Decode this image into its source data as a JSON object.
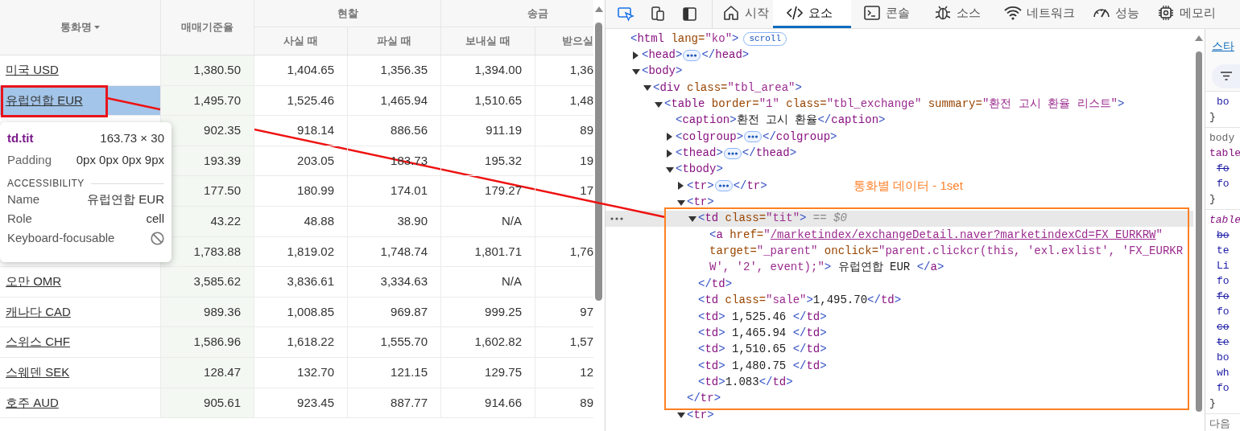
{
  "rate_table": {
    "header": {
      "currency": "통화명",
      "base_rate": "매매기준율",
      "cash": "현찰",
      "cash_buy": "사실 때",
      "cash_sell": "파실 때",
      "remit": "송금",
      "remit_send": "보내실 때",
      "remit_receive": "받으실"
    },
    "rows": [
      {
        "name": "미국 USD",
        "values": [
          "1,380.50",
          "1,404.65",
          "1,356.35",
          "1,394.00",
          "1,36"
        ]
      },
      {
        "name": "유럽연합 EUR",
        "values": [
          "1,495.70",
          "1,525.46",
          "1,465.94",
          "1,510.65",
          "1,48"
        ]
      },
      {
        "values": [
          "902.35",
          "918.14",
          "886.56",
          "911.19",
          "89"
        ]
      },
      {
        "values": [
          "193.39",
          "203.05",
          "183.73",
          "195.32",
          "19"
        ]
      },
      {
        "values": [
          "177.50",
          "180.99",
          "174.01",
          "179.27",
          "17"
        ]
      },
      {
        "values": [
          "43.22",
          "48.88",
          "38.90",
          "N/A"
        ]
      },
      {
        "values": [
          "1,783.88",
          "1,819.02",
          "1,748.74",
          "1,801.71",
          "1,76"
        ]
      },
      {
        "name": "오만 OMR",
        "values": [
          "3,585.62",
          "3,836.61",
          "3,334.63",
          "N/A"
        ]
      },
      {
        "name": "캐나다 CAD",
        "values": [
          "989.36",
          "1,008.85",
          "969.87",
          "999.25",
          "97"
        ]
      },
      {
        "name": "스위스 CHF",
        "values": [
          "1,586.96",
          "1,618.22",
          "1,555.70",
          "1,602.82",
          "1,57"
        ]
      },
      {
        "name": "스웨덴 SEK",
        "values": [
          "128.47",
          "132.70",
          "121.15",
          "129.75",
          "12"
        ]
      },
      {
        "name": "호주 AUD",
        "values": [
          "905.61",
          "923.45",
          "887.77",
          "914.66",
          "89"
        ]
      }
    ]
  },
  "inspector_tooltip": {
    "selector": "td.tit",
    "size": "163.73 × 30",
    "padding_label": "Padding",
    "padding": "0px 0px 0px 9px",
    "section": "ACCESSIBILITY",
    "properties": [
      {
        "label": "Name",
        "value": "유럽연합 EUR",
        "kind": "text"
      },
      {
        "label": "Role",
        "value": "cell",
        "kind": "text"
      },
      {
        "label": "Keyboard-focusable",
        "kind": "blocked"
      }
    ]
  },
  "devtools": {
    "tabs": [
      {
        "label": "시작",
        "selected": false
      },
      {
        "label": "요소",
        "selected": true
      },
      {
        "label": "콘솔",
        "selected": false
      },
      {
        "label": "소스",
        "selected": false
      },
      {
        "label": "네트워크",
        "selected": false
      },
      {
        "label": "성능",
        "selected": false
      },
      {
        "label": "메모리",
        "selected": false
      }
    ],
    "dom_tree": [
      {
        "selected": false,
        "lines": [
          [
            {
              "kind": "bracket",
              "text": "<"
            },
            {
              "kind": "tag",
              "text": "html"
            },
            {
              "kind": "attr",
              "text": " lang="
            },
            {
              "kind": "value",
              "text": "\"ko\""
            },
            {
              "kind": "bracket",
              "text": ">"
            },
            {
              "kind": "badge",
              "text": "scroll"
            }
          ]
        ],
        "children": [
          {
            "selected": false,
            "expanded": false,
            "lines": [
              [
                {
                  "kind": "bracket",
                  "text": "<"
                },
                {
                  "kind": "tag",
                  "text": "head"
                },
                {
                  "kind": "bracket",
                  "text": ">"
                },
                {
                  "kind": "more"
                },
                {
                  "kind": "bracket",
                  "text": "</"
                },
                {
                  "kind": "tag",
                  "text": "head"
                },
                {
                  "kind": "bracket",
                  "text": ">"
                }
              ]
            ]
          },
          {
            "selected": false,
            "expanded": true,
            "lines": [
              [
                {
                  "kind": "bracket",
                  "text": "<"
                },
                {
                  "kind": "tag",
                  "text": "body"
                },
                {
                  "kind": "bracket",
                  "text": ">"
                }
              ]
            ],
            "children": [
              {
                "selected": false,
                "expanded": true,
                "lines": [
                  [
                    {
                      "kind": "bracket",
                      "text": "<"
                    },
                    {
                      "kind": "tag",
                      "text": "div"
                    },
                    {
                      "kind": "attr",
                      "text": " class="
                    },
                    {
                      "kind": "value",
                      "text": "\"tbl_area\""
                    },
                    {
                      "kind": "bracket",
                      "text": ">"
                    }
                  ]
                ],
                "children": [
                  {
                    "selected": false,
                    "expanded": true,
                    "lines": [
                      [
                        {
                          "kind": "bracket",
                          "text": "<"
                        },
                        {
                          "kind": "tag",
                          "text": "table"
                        },
                        {
                          "kind": "attr",
                          "text": " border="
                        },
                        {
                          "kind": "value",
                          "text": "\"1\""
                        },
                        {
                          "kind": "attr",
                          "text": " class="
                        },
                        {
                          "kind": "value",
                          "text": "\"tbl_exchange\""
                        },
                        {
                          "kind": "attr",
                          "text": " summary="
                        },
                        {
                          "kind": "value",
                          "text": "\"환전 고시 환율 리스트\""
                        },
                        {
                          "kind": "bracket",
                          "text": ">"
                        }
                      ]
                    ],
                    "children": [
                      {
                        "selected": false,
                        "lines": [
                          [
                            {
                              "kind": "bracket",
                              "text": "<"
                            },
                            {
                              "kind": "tag",
                              "text": "caption"
                            },
                            {
                              "kind": "bracket",
                              "text": ">"
                            },
                            {
                              "kind": "text",
                              "text": "환전 고시 환율"
                            },
                            {
                              "kind": "bracket",
                              "text": "</"
                            },
                            {
                              "kind": "tag",
                              "text": "caption"
                            },
                            {
                              "kind": "bracket",
                              "text": ">"
                            }
                          ]
                        ]
                      },
                      {
                        "selected": false,
                        "expanded": false,
                        "lines": [
                          [
                            {
                              "kind": "bracket",
                              "text": "<"
                            },
                            {
                              "kind": "tag",
                              "text": "colgroup"
                            },
                            {
                              "kind": "bracket",
                              "text": ">"
                            },
                            {
                              "kind": "more"
                            },
                            {
                              "kind": "bracket",
                              "text": "</"
                            },
                            {
                              "kind": "tag",
                              "text": "colgroup"
                            },
                            {
                              "kind": "bracket",
                              "text": ">"
                            }
                          ]
                        ]
                      },
                      {
                        "selected": false,
                        "expanded": false,
                        "lines": [
                          [
                            {
                              "kind": "bracket",
                              "text": "<"
                            },
                            {
                              "kind": "tag",
                              "text": "thead"
                            },
                            {
                              "kind": "bracket",
                              "text": ">"
                            },
                            {
                              "kind": "more"
                            },
                            {
                              "kind": "bracket",
                              "text": "</"
                            },
                            {
                              "kind": "tag",
                              "text": "thead"
                            },
                            {
                              "kind": "bracket",
                              "text": ">"
                            }
                          ]
                        ]
                      },
                      {
                        "selected": false,
                        "expanded": true,
                        "lines": [
                          [
                            {
                              "kind": "bracket",
                              "text": "<"
                            },
                            {
                              "kind": "tag",
                              "text": "tbody"
                            },
                            {
                              "kind": "bracket",
                              "text": ">"
                            }
                          ]
                        ],
                        "children": [
                          {
                            "selected": false,
                            "expanded": false,
                            "lines": [
                              [
                                {
                                  "kind": "bracket",
                                  "text": "<"
                                },
                                {
                                  "kind": "tag",
                                  "text": "tr"
                                },
                                {
                                  "kind": "bracket",
                                  "text": ">"
                                },
                                {
                                  "kind": "more"
                                },
                                {
                                  "kind": "bracket",
                                  "text": "</"
                                },
                                {
                                  "kind": "tag",
                                  "text": "tr"
                                },
                                {
                                  "kind": "bracket",
                                  "text": ">"
                                }
                              ]
                            ]
                          },
                          {
                            "selected": false,
                            "expanded": true,
                            "lines": [
                              [
                                {
                                  "kind": "bracket",
                                  "text": "<"
                                },
                                {
                                  "kind": "tag",
                                  "text": "tr"
                                },
                                {
                                  "kind": "bracket",
                                  "text": ">"
                                }
                              ]
                            ],
                            "closing": [
                              {
                                "kind": "bracket",
                                "text": "</"
                              },
                              {
                                "kind": "tag",
                                "text": "tr"
                              },
                              {
                                "kind": "bracket",
                                "text": ">"
                              }
                            ],
                            "children": [
                              {
                                "selected": true,
                                "expanded": true,
                                "lines": [
                                  [
                                    {
                                      "kind": "bracket",
                                      "text": "<"
                                    },
                                    {
                                      "kind": "tag",
                                      "text": "td"
                                    },
                                    {
                                      "kind": "attr",
                                      "text": " class="
                                    },
                                    {
                                      "kind": "value",
                                      "text": "\"tit\""
                                    },
                                    {
                                      "kind": "bracket",
                                      "text": ">"
                                    },
                                    {
                                      "kind": "marker",
                                      "text": " == $0"
                                    }
                                  ]
                                ],
                                "closing": [
                                  {
                                    "kind": "bracket",
                                    "text": "</"
                                  },
                                  {
                                    "kind": "tag",
                                    "text": "td"
                                  },
                                  {
                                    "kind": "bracket",
                                    "text": ">"
                                  }
                                ],
                                "children": [
                                  {
                                    "selected": false,
                                    "lines": [
                                      [
                                        {
                                          "kind": "bracket",
                                          "text": "<"
                                        },
                                        {
                                          "kind": "tag",
                                          "text": "a"
                                        },
                                        {
                                          "kind": "attr",
                                          "text": " href="
                                        },
                                        {
                                          "kind": "value",
                                          "text": "\""
                                        },
                                        {
                                          "kind": "link",
                                          "text": "/marketindex/exchangeDetail.naver?marketindexCd=FX_EURKRW"
                                        },
                                        {
                                          "kind": "value",
                                          "text": "\""
                                        }
                                      ],
                                      [
                                        {
                                          "kind": "attr",
                                          "text": "target="
                                        },
                                        {
                                          "kind": "value",
                                          "text": "\"_parent\""
                                        },
                                        {
                                          "kind": "attr",
                                          "text": " onclick="
                                        },
                                        {
                                          "kind": "value",
                                          "text": "\"parent.clickcr(this, 'exl.exlist', 'FX_EURKR"
                                        }
                                      ],
                                      [
                                        {
                                          "kind": "value",
                                          "text": "W', '2', event);\""
                                        },
                                        {
                                          "kind": "bracket",
                                          "text": ">"
                                        },
                                        {
                                          "kind": "text",
                                          "text": " 유럽연합 EUR "
                                        },
                                        {
                                          "kind": "bracket",
                                          "text": "</"
                                        },
                                        {
                                          "kind": "tag",
                                          "text": "a"
                                        },
                                        {
                                          "kind": "bracket",
                                          "text": ">"
                                        }
                                      ]
                                    ]
                                  }
                                ]
                              },
                              {
                                "selected": false,
                                "lines": [
                                  [
                                    {
                                      "kind": "bracket",
                                      "text": "<"
                                    },
                                    {
                                      "kind": "tag",
                                      "text": "td"
                                    },
                                    {
                                      "kind": "attr",
                                      "text": " class="
                                    },
                                    {
                                      "kind": "value",
                                      "text": "\"sale\""
                                    },
                                    {
                                      "kind": "bracket",
                                      "text": ">"
                                    },
                                    {
                                      "kind": "text",
                                      "text": "1,495.70"
                                    },
                                    {
                                      "kind": "bracket",
                                      "text": "</"
                                    },
                                    {
                                      "kind": "tag",
                                      "text": "td"
                                    },
                                    {
                                      "kind": "bracket",
                                      "text": ">"
                                    }
                                  ]
                                ]
                              },
                              {
                                "selected": false,
                                "lines": [
                                  [
                                    {
                                      "kind": "bracket",
                                      "text": "<"
                                    },
                                    {
                                      "kind": "tag",
                                      "text": "td"
                                    },
                                    {
                                      "kind": "bracket",
                                      "text": ">"
                                    },
                                    {
                                      "kind": "text",
                                      "text": " 1,525.46 "
                                    },
                                    {
                                      "kind": "bracket",
                                      "text": "</"
                                    },
                                    {
                                      "kind": "tag",
                                      "text": "td"
                                    },
                                    {
                                      "kind": "bracket",
                                      "text": ">"
                                    }
                                  ]
                                ]
                              },
                              {
                                "selected": false,
                                "lines": [
                                  [
                                    {
                                      "kind": "bracket",
                                      "text": "<"
                                    },
                                    {
                                      "kind": "tag",
                                      "text": "td"
                                    },
                                    {
                                      "kind": "bracket",
                                      "text": ">"
                                    },
                                    {
                                      "kind": "text",
                                      "text": " 1,465.94 "
                                    },
                                    {
                                      "kind": "bracket",
                                      "text": "</"
                                    },
                                    {
                                      "kind": "tag",
                                      "text": "td"
                                    },
                                    {
                                      "kind": "bracket",
                                      "text": ">"
                                    }
                                  ]
                                ]
                              },
                              {
                                "selected": false,
                                "lines": [
                                  [
                                    {
                                      "kind": "bracket",
                                      "text": "<"
                                    },
                                    {
                                      "kind": "tag",
                                      "text": "td"
                                    },
                                    {
                                      "kind": "bracket",
                                      "text": ">"
                                    },
                                    {
                                      "kind": "text",
                                      "text": " 1,510.65 "
                                    },
                                    {
                                      "kind": "bracket",
                                      "text": "</"
                                    },
                                    {
                                      "kind": "tag",
                                      "text": "td"
                                    },
                                    {
                                      "kind": "bracket",
                                      "text": ">"
                                    }
                                  ]
                                ]
                              },
                              {
                                "selected": false,
                                "lines": [
                                  [
                                    {
                                      "kind": "bracket",
                                      "text": "<"
                                    },
                                    {
                                      "kind": "tag",
                                      "text": "td"
                                    },
                                    {
                                      "kind": "bracket",
                                      "text": ">"
                                    },
                                    {
                                      "kind": "text",
                                      "text": " 1,480.75 "
                                    },
                                    {
                                      "kind": "bracket",
                                      "text": "</"
                                    },
                                    {
                                      "kind": "tag",
                                      "text": "td"
                                    },
                                    {
                                      "kind": "bracket",
                                      "text": ">"
                                    }
                                  ]
                                ]
                              },
                              {
                                "selected": false,
                                "lines": [
                                  [
                                    {
                                      "kind": "bracket",
                                      "text": "<"
                                    },
                                    {
                                      "kind": "tag",
                                      "text": "td"
                                    },
                                    {
                                      "kind": "bracket",
                                      "text": ">"
                                    },
                                    {
                                      "kind": "text",
                                      "text": "1.083"
                                    },
                                    {
                                      "kind": "bracket",
                                      "text": "</"
                                    },
                                    {
                                      "kind": "tag",
                                      "text": "td"
                                    },
                                    {
                                      "kind": "bracket",
                                      "text": ">"
                                    }
                                  ]
                                ]
                              }
                            ]
                          },
                          {
                            "selected": false,
                            "expanded": true,
                            "lines": [
                              [
                                {
                                  "kind": "bracket",
                                  "text": "<"
                                },
                                {
                                  "kind": "tag",
                                  "text": "tr"
                                },
                                {
                                  "kind": "bracket",
                                  "text": ">"
                                }
                              ]
                            ]
                          }
                        ]
                      }
                    ]
                  }
                ]
              }
            ]
          }
        ]
      }
    ],
    "styles_pane": {
      "tab": "스타",
      "sections": [
        [
          {
            "text": "bo",
            "kind": "prop"
          },
          {
            "text": "}",
            "kind": "brace"
          }
        ],
        [
          {
            "text": "body",
            "kind": "inherited"
          },
          {
            "text": "table",
            "kind": "selector"
          },
          {
            "text": "fo",
            "kind": "struck"
          },
          {
            "text": "fo",
            "kind": "prop"
          },
          {
            "text": "}",
            "kind": "brace"
          }
        ],
        [
          {
            "text": "table",
            "kind": "agent"
          },
          {
            "text": "bo",
            "kind": "struck"
          },
          {
            "text": "te",
            "kind": "prop"
          },
          {
            "text": "Li",
            "kind": "prop"
          },
          {
            "text": "fo",
            "kind": "prop"
          },
          {
            "text": "fo",
            "kind": "struck"
          },
          {
            "text": "fo",
            "kind": "prop"
          },
          {
            "text": "co",
            "kind": "struck"
          },
          {
            "text": "te",
            "kind": "struck"
          },
          {
            "text": "bo",
            "kind": "prop"
          },
          {
            "text": "wh",
            "kind": "prop"
          },
          {
            "text": "fo",
            "kind": "prop"
          },
          {
            "text": "}",
            "kind": "brace"
          }
        ],
        [
          {
            "text": "다음",
            "kind": "inherited"
          }
        ]
      ]
    }
  },
  "annotation": {
    "label": "통화별 데이터 - 1set"
  }
}
